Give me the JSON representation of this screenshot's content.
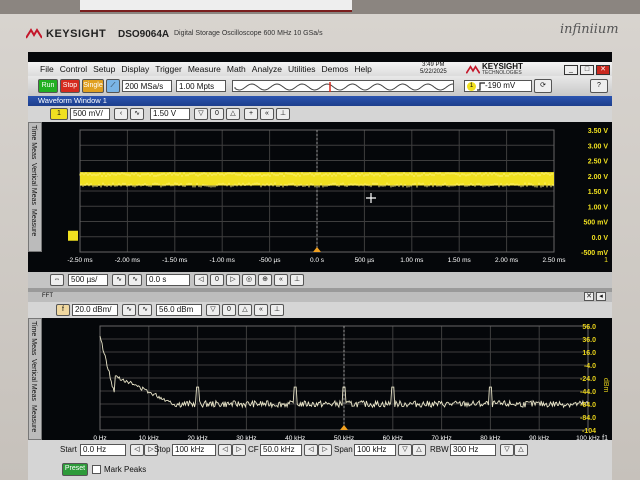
{
  "instrument": {
    "brand": "KEYSIGHT",
    "model": "DSO9064A",
    "description": "Digital Storage Oscilloscope 600 MHz 10 GSa/s",
    "series": "infiniium"
  },
  "menubar": {
    "items": [
      "File",
      "Control",
      "Setup",
      "Display",
      "Trigger",
      "Measure",
      "Math",
      "Analyze",
      "Utilities",
      "Demos",
      "Help"
    ],
    "time": "3:49 PM",
    "date": "5/22/2025",
    "logo_text": "KEYSIGHT",
    "logo_sub": "TECHNOLOGIES",
    "window_buttons": [
      "_",
      "□",
      "✕"
    ]
  },
  "toolbar": {
    "run": "Run",
    "stop": "Stop",
    "single": "Single",
    "sample_rate": "200 MSa/s",
    "memory_depth": "1.00 Mpts",
    "trigger_channel": "1",
    "trigger_level": "-190 mV"
  },
  "waveform_window": {
    "title": "Waveform Window 1",
    "channel": "1",
    "scale": "500 mV/",
    "offset": "1.50 V",
    "side_tabs": [
      "Time Meas",
      "Vertical Meas",
      "Measure"
    ],
    "y_labels": [
      "3.50 V",
      "3.00 V",
      "2.50 V",
      "2.00 V",
      "1.50 V",
      "1.00 V",
      "500 mV",
      "0.0 V",
      "-500 mV"
    ],
    "x_labels": [
      "-2.50 ms",
      "-2.00 ms",
      "-1.50 ms",
      "-1.00 ms",
      "-500 µs",
      "0.0 s",
      "500 µs",
      "1.00 ms",
      "1.50 ms",
      "2.00 ms",
      "2.50 ms"
    ],
    "right_marker": "1",
    "timebase": "500 µs/",
    "position": "0.0 s"
  },
  "fft_window": {
    "title": "FFT",
    "scale": "20.0 dBm/",
    "offset": "56.0 dBm",
    "side_tabs": [
      "Time Meas",
      "Vertical Meas",
      "Measure"
    ],
    "y_labels": [
      "56.0",
      "36.0",
      "16.0",
      "-4.0",
      "-24.0",
      "-44.0",
      "-64.0",
      "-84.0",
      "-104"
    ],
    "y_unit": "dBm",
    "x_labels": [
      "0 Hz",
      "10 kHz",
      "20 kHz",
      "30 kHz",
      "40 kHz",
      "50 kHz",
      "60 kHz",
      "70 kHz",
      "80 kHz",
      "90 kHz",
      "100 kHz"
    ],
    "right_marker": "f1",
    "start_label": "Start",
    "start": "0.0 Hz",
    "stop_label": "Stop",
    "stop": "100 kHz",
    "cf_label": "CF",
    "cf": "50.0 kHz",
    "span_label": "Span",
    "span": "100 kHz",
    "rbw_label": "RBW",
    "rbw": "300 Hz",
    "preset": "Preset",
    "mark_peaks": "Mark Peaks"
  },
  "colors": {
    "channel1": "#f0e020",
    "fft_trace": "#e8e4c8",
    "grid": "#4a4a4a",
    "menu_blue": "#2b54b0"
  },
  "signal": {
    "time_domain_level_v": 1.9,
    "time_domain_band_v": [
      1.68,
      2.12
    ],
    "fft_noise_floor_dbm": -64,
    "fft_peaks_khz": [
      20,
      40,
      50,
      60,
      80
    ]
  }
}
